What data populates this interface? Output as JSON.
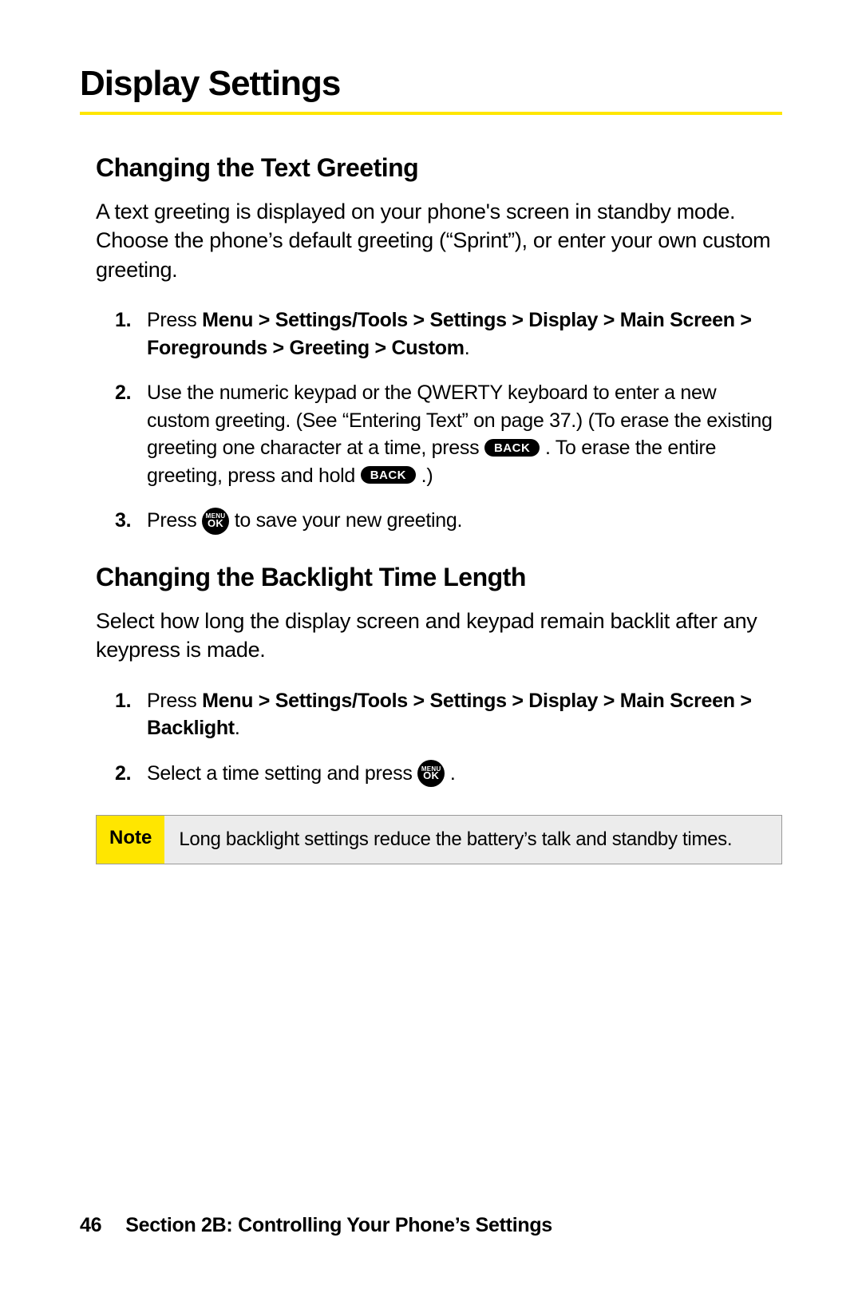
{
  "title": "Display Settings",
  "section1": {
    "heading": "Changing the Text Greeting",
    "intro": "A text greeting is displayed on your phone's screen in standby mode. Choose the phone’s default greeting (“Sprint”), or enter your own custom greeting.",
    "step1_prefix": "Press ",
    "step1_bold": "Menu > Settings/Tools > Settings > Display > Main Screen > Foregrounds > Greeting > Custom",
    "step1_suffix": ".",
    "step2_a": "Use the numeric keypad or the QWERTY keyboard to enter a new custom greeting. (See “Entering Text” on page 37.) (To erase the existing greeting one character at a time, press ",
    "step2_b": " . To erase the entire greeting, press and hold ",
    "step2_c": " .)",
    "step3_a": "Press ",
    "step3_b": " to save your new greeting."
  },
  "section2": {
    "heading": "Changing the Backlight Time Length",
    "intro": "Select how long the display screen and keypad remain backlit after any keypress is made.",
    "step1_prefix": "Press ",
    "step1_bold": "Menu > Settings/Tools > Settings > Display > Main Screen > Backlight",
    "step1_suffix": ".",
    "step2_a": "Select a time setting and press ",
    "step2_b": " ."
  },
  "note": {
    "label": "Note",
    "text": "Long backlight settings reduce the battery’s talk and standby times."
  },
  "keys": {
    "back": "BACK",
    "menu_top": "MENU",
    "menu_bot": "OK"
  },
  "footer": {
    "page": "46",
    "text": "Section 2B: Controlling Your Phone’s Settings"
  }
}
